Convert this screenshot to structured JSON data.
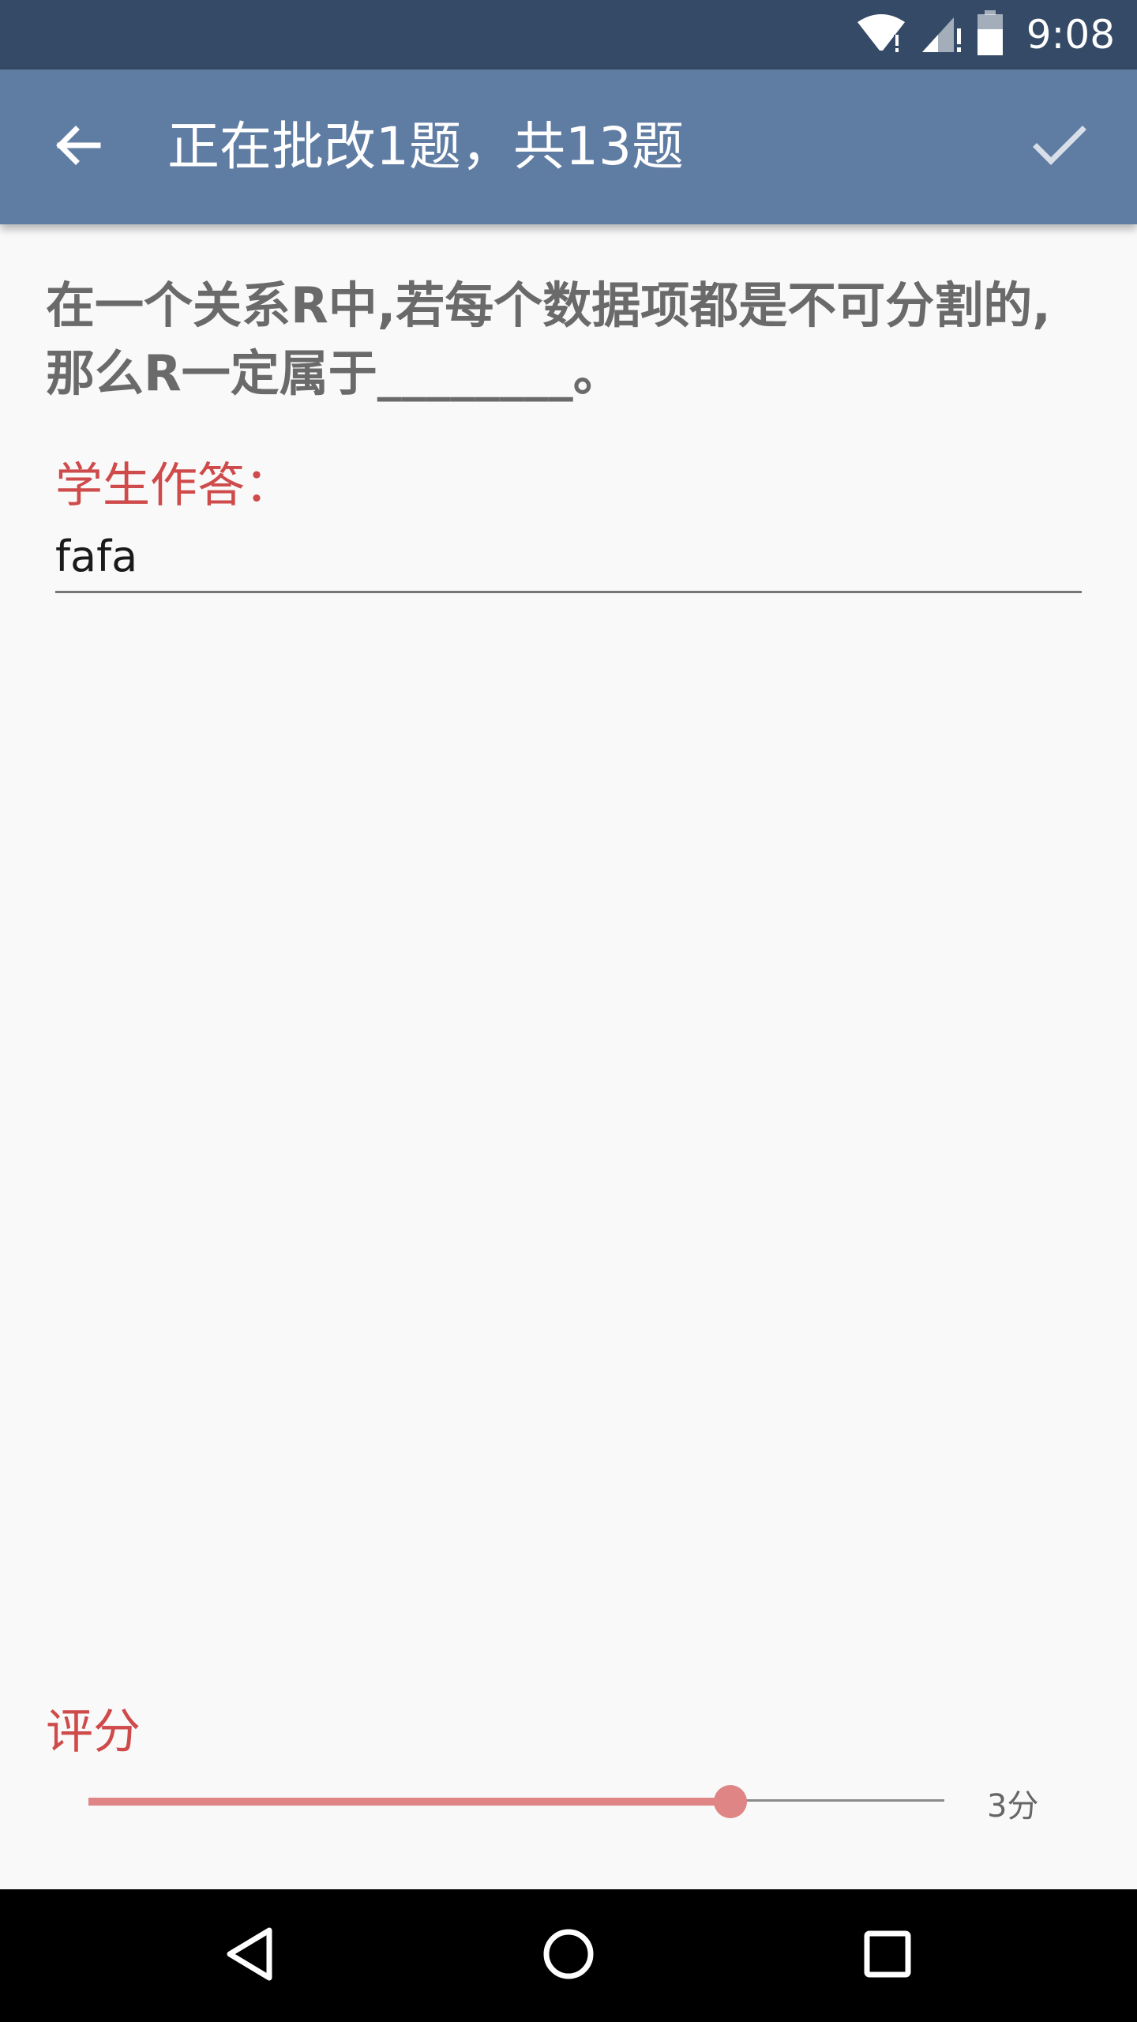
{
  "status_bar": {
    "time": "9:08",
    "icons": [
      "wifi-alert-icon",
      "cell-signal-alert-icon",
      "battery-icon"
    ]
  },
  "app_bar": {
    "title": "正在批改1题，共13题",
    "back_icon": "arrow-back-icon",
    "confirm_icon": "check-icon"
  },
  "question": {
    "text": " 在一个关系R中,若每个数据项都是不可分割的,那么R一定属于________。"
  },
  "answer": {
    "label": "学生作答：",
    "value": "fafa"
  },
  "score": {
    "label": "评分",
    "value_label": "3分",
    "value": 3,
    "fill_fraction": 0.75
  },
  "nav_bar": {
    "icons": [
      "back-triangle-icon",
      "home-circle-icon",
      "recents-square-icon"
    ]
  },
  "colors": {
    "status_bar": "#354a66",
    "app_bar": "#5f7ca3",
    "accent_red": "#cf4a4a",
    "slider_pink": "#e08585",
    "background": "#f9f9f9"
  }
}
